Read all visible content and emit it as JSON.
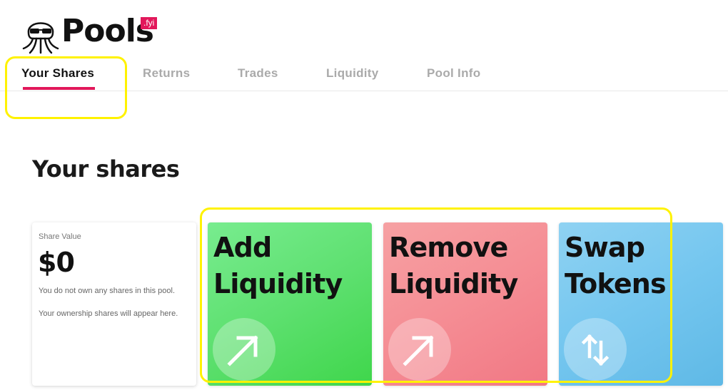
{
  "brand": {
    "name": "Pools",
    "badge": ".fyi",
    "badge_color": "#e2185b",
    "mascot_icon": "octopus-with-sunglasses-icon"
  },
  "tabs": [
    {
      "label": "Your Shares",
      "active": true
    },
    {
      "label": "Returns",
      "active": false
    },
    {
      "label": "Trades",
      "active": false
    },
    {
      "label": "Liquidity",
      "active": false
    },
    {
      "label": "Pool Info",
      "active": false
    }
  ],
  "accent_color": "#e2185b",
  "highlight_color": "#fff200",
  "section": {
    "title": "Your shares"
  },
  "share_card": {
    "label": "Share Value",
    "value": "$0",
    "note_1": "You do not own any shares in this pool.",
    "note_2": "Your ownership shares will appear here."
  },
  "actions": {
    "add": {
      "line1": "Add",
      "line2": "Liquidity",
      "icon": "arrow-up-right-icon",
      "color": "#5ee070"
    },
    "remove": {
      "line1": "Remove",
      "line2": "Liquidity",
      "icon": "arrow-up-right-icon",
      "color": "#f58d94"
    },
    "swap": {
      "line1": "Swap",
      "line2": "Tokens",
      "icon": "swap-vertical-arrows-icon",
      "color": "#74c6ef"
    }
  }
}
